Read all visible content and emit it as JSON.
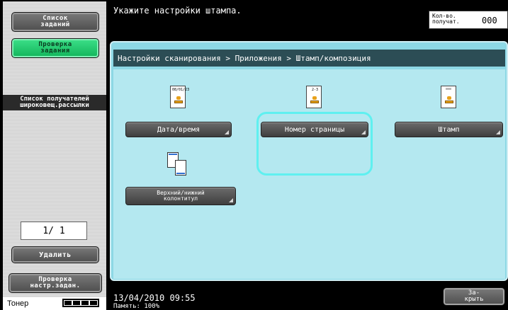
{
  "left_panel": {
    "job_list_label": "Список\nзаданий",
    "job_check_label": "Проверка\nзадания",
    "recipients_label": "Список получателей\nшироковещ.рассылки",
    "page_indicator": "1/  1",
    "delete_label": "Удалить",
    "check_settings_label": "Проверка\nнастр.задан.",
    "toner_label": "Тонер",
    "toner_level_segments": 4
  },
  "header": {
    "message": "Укажите настройки штампа.",
    "count_label": "Кол-во.\nполучат.",
    "count_value": "000"
  },
  "main": {
    "breadcrumb": "Настройки сканирования > Приложения > Штамп/композиция",
    "date_icon_text": "08/01/23",
    "page_icon_text": "2-3",
    "buttons": {
      "date_time": "Дата/время",
      "page_number": "Номер страницы",
      "stamp": "Штамп",
      "header_footer": "Верхний/нижний\nколонтитул"
    }
  },
  "footer": {
    "datetime": "13/04/2010    09:55",
    "subtext": "Память:       100%",
    "close_label": "За-\nкрыть"
  },
  "colors": {
    "accent": "#8dd8e5",
    "selected": "#5ff0f0",
    "green_button": "#1fcf72"
  }
}
